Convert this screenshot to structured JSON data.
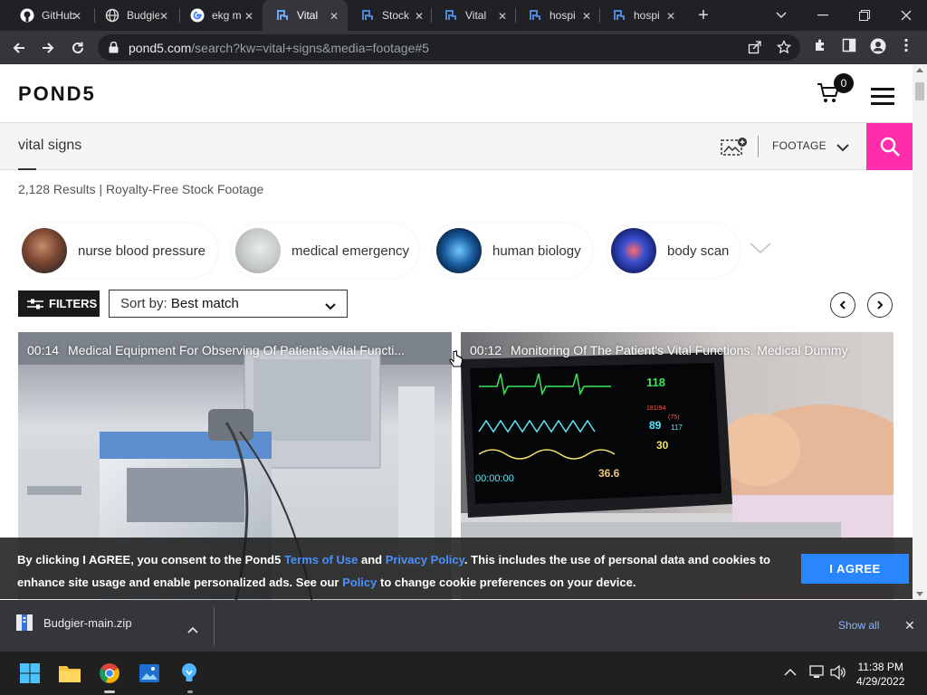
{
  "browser": {
    "tabs": [
      {
        "title": "GitHub",
        "icon": "github-icon"
      },
      {
        "title": "Budgie",
        "icon": "globe-icon"
      },
      {
        "title": "ekg m",
        "icon": "google-icon"
      },
      {
        "title": "Vital",
        "icon": "pond5-icon",
        "active": true
      },
      {
        "title": "Stock",
        "icon": "pond5-icon"
      },
      {
        "title": "Vital",
        "icon": "pond5-icon"
      },
      {
        "title": "hospi",
        "icon": "pond5-icon"
      },
      {
        "title": "hospi",
        "icon": "pond5-icon"
      }
    ],
    "url_host": "pond5.com",
    "url_path": "/search?kw=vital+signs&media=footage#5"
  },
  "site": {
    "logo": "POND5",
    "cart_count": "0",
    "search_query": "vital signs",
    "media_type": "FOOTAGE",
    "results_summary": "2,128 Results | Royalty-Free Stock Footage",
    "chips": [
      {
        "label": "nurse blood pressure"
      },
      {
        "label": "medical emergency"
      },
      {
        "label": "human biology"
      },
      {
        "label": "body scan"
      }
    ],
    "filters_label": "FILTERS",
    "sort_prefix": "Sort by:",
    "sort_value": "Best match",
    "clips": [
      {
        "duration": "00:14",
        "title": "Medical Equipment For Observing Of Patient's Vital Functi..."
      },
      {
        "duration": "00:12",
        "title": "Monitoring Of The Patient's Vital Functions. Medical Dummy"
      }
    ]
  },
  "monitor_readout": {
    "hr": "118",
    "red1": "181/94",
    "red2": "(75)",
    "spo2": "89",
    "rr": "117",
    "pulse": "30",
    "temp": "36.6",
    "timer": "00:00:00"
  },
  "cookie": {
    "text1": "By clicking I AGREE, you consent to the Pond5 ",
    "link_terms": "Terms of Use",
    "text2": " and ",
    "link_privacy": "Privacy Policy",
    "text3": ". This includes the use of personal data and cookies to enhance site usage and enable personalized ads. See our ",
    "link_policy": "Policy",
    "text4": " to change cookie preferences on your device.",
    "agree_label": "I AGREE"
  },
  "downloads": {
    "file_name": "Budgier-main.zip",
    "show_all": "Show all"
  },
  "taskbar": {
    "time": "11:38 PM",
    "date": "4/29/2022"
  },
  "colors": {
    "accent_pink": "#ff2dac",
    "agree_blue": "#2a86ff",
    "link_blue": "#4a90ff"
  }
}
